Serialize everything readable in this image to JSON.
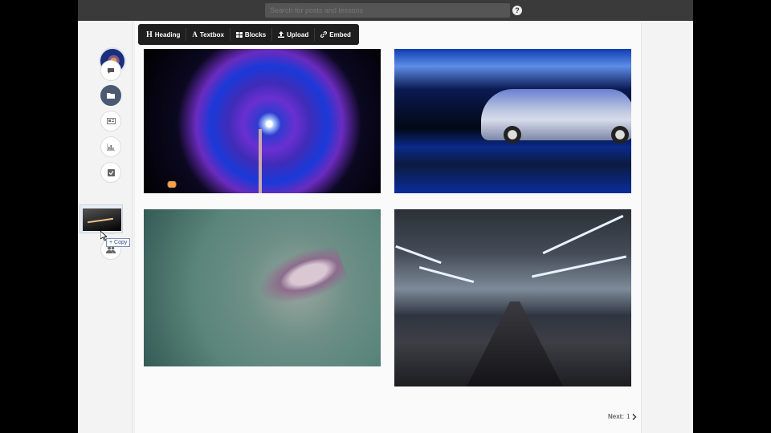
{
  "topbar": {
    "search_placeholder": "Search for posts and lessons",
    "help_label": "?"
  },
  "sidebar": {
    "avatar": "user-avatar",
    "items": [
      {
        "icon": "chat-icon",
        "active": false
      },
      {
        "icon": "folder-icon",
        "active": true
      },
      {
        "icon": "media-icon",
        "active": false
      },
      {
        "icon": "chart-icon",
        "active": false
      },
      {
        "icon": "checklist-icon",
        "active": false
      },
      {
        "icon": "blank-icon",
        "active": false
      },
      {
        "icon": "users-icon",
        "active": false
      }
    ]
  },
  "drag": {
    "tooltip": "Copy"
  },
  "toolbar": {
    "heading_label": "Heading",
    "textbox_label": "Textbox",
    "blocks_label": "Blocks",
    "upload_label": "Upload",
    "embed_label": "Embed"
  },
  "gallery": {
    "images": [
      "ferris-wheel-photo",
      "car-photo",
      "hummingbird-photo",
      "train-station-photo"
    ]
  },
  "pagination": {
    "next_label": "Next:",
    "page": "1"
  },
  "colors": {
    "topbar": "#3a3a3a",
    "toolbar": "#1f1f1f",
    "active_nav": "#4a5a70"
  }
}
